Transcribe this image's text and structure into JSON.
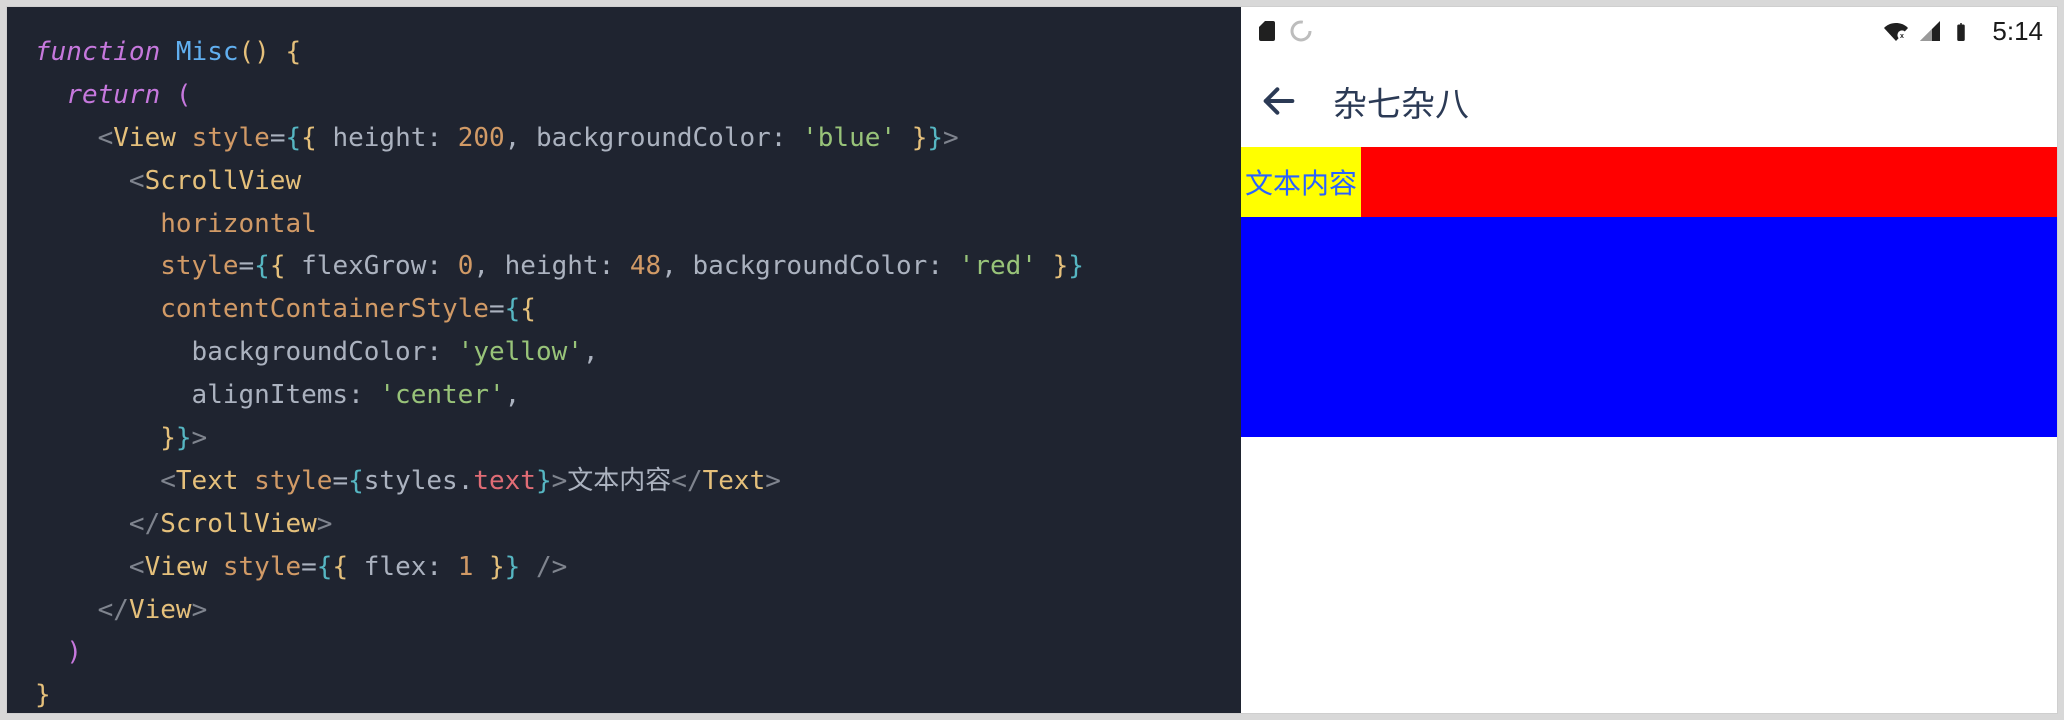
{
  "code": {
    "tokens": {
      "kw_function": "function",
      "func_name": "Misc",
      "kw_return": "return",
      "tag_View": "View",
      "tag_ScrollView": "ScrollView",
      "tag_Text": "Text",
      "attr_style": "style",
      "attr_horizontal": "horizontal",
      "attr_contentContainerStyle": "contentContainerStyle",
      "prop_height": "height",
      "prop_backgroundColor": "backgroundColor",
      "prop_flexGrow": "flexGrow",
      "prop_alignItems": "alignItems",
      "prop_flex": "flex",
      "val_200": "200",
      "val_blue": "'blue'",
      "val_0": "0",
      "val_48": "48",
      "val_red": "'red'",
      "val_yellow": "'yellow'",
      "val_center": "'center'",
      "val_1": "1",
      "ident_styles": "styles",
      "member_text": "text",
      "text_literal": "文本内容"
    }
  },
  "phone": {
    "status": {
      "time": "5:14"
    },
    "appbar": {
      "title": "杂七杂八"
    },
    "content": {
      "text": "文本内容"
    },
    "colors": {
      "view_bg": "blue",
      "scroll_bg": "red",
      "content_bg": "yellow",
      "text_color": "#2962ff"
    }
  }
}
